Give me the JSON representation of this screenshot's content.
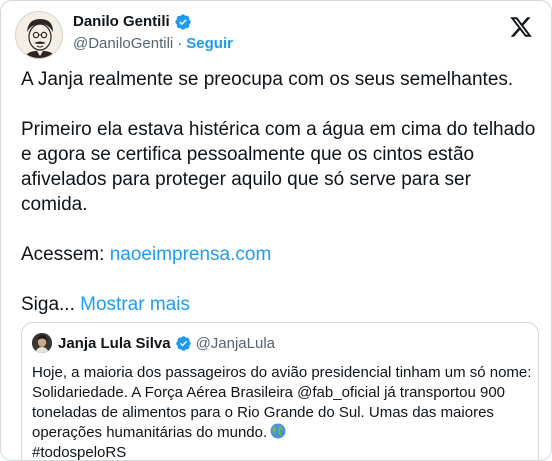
{
  "author": {
    "display_name": "Danilo Gentili",
    "handle": "@DaniloGentili",
    "separator": "·",
    "follow_label": "Seguir"
  },
  "tweet": {
    "paragraph_1": "A Janja realmente se preocupa com os seus semelhantes.",
    "paragraph_2": "Primeiro ela estava histérica com a água em cima do telhado e agora se certifica pessoalmente que os cintos estão afivelados para proteger aquilo que só serve para ser comida.",
    "acessem_label": "Acessem:",
    "link_text": "naoeimprensa.com",
    "siga_text": "Siga...",
    "show_more_label": "Mostrar mais"
  },
  "quoted": {
    "display_name": "Janja Lula Silva",
    "handle": "@JanjaLula",
    "text": "Hoje, a maioria dos passageiros do avião presidencial tinham um só nome: Solidariedade. A Força Aérea Brasileira @fab_oficial já transportou 900 toneladas de alimentos para o Rio Grande do Sul. Umas das maiores operações humanitárias do mundo.",
    "hashtag": "#todospeloRS"
  },
  "icons": {
    "verified": "verified-badge-icon",
    "x_logo": "x-logo-icon",
    "globe": "globe-emoji-icon"
  },
  "colors": {
    "accent": "#1d9bf0",
    "secondary_text": "#536471",
    "border": "#cfd9de"
  }
}
